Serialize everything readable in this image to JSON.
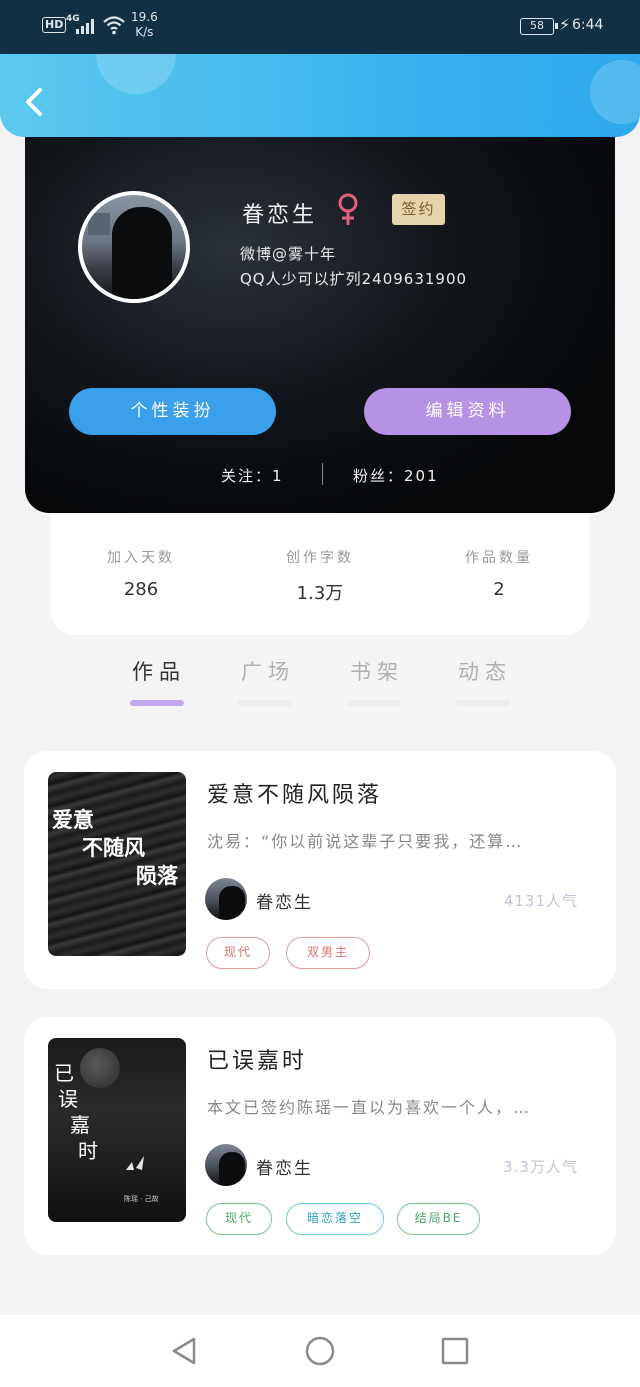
{
  "status_bar": {
    "hd": "HD",
    "network": "4G",
    "speed_value": "19.6",
    "speed_unit": "K/s",
    "battery": "58",
    "time": "6:44"
  },
  "header": {
    "back_icon": "chevron-left-icon"
  },
  "profile": {
    "name": "眷恋生",
    "gender_icon": "female-icon",
    "badge": "签约",
    "bio_line1": "微博@雾十年",
    "bio_line2": "QQ人少可以扩列2409631900",
    "dress_button": "个性装扮",
    "edit_button": "编辑资料",
    "following": "关注：1",
    "fans": "粉丝：201"
  },
  "stats": [
    {
      "label": "加入天数",
      "value": "286"
    },
    {
      "label": "创作字数",
      "value": "1.3万"
    },
    {
      "label": "作品数量",
      "value": "2"
    }
  ],
  "tabs": [
    {
      "label": "作品",
      "active": true
    },
    {
      "label": "广场",
      "active": false
    },
    {
      "label": "书架",
      "active": false
    },
    {
      "label": "动态",
      "active": false
    }
  ],
  "works": [
    {
      "title": "爱意不随风陨落",
      "cover_line1": "爱意",
      "cover_line2": "不随风",
      "cover_line3": "陨落",
      "description": "沈易：“你以前说这辈子只要我，还算…",
      "author": "眷恋生",
      "popularity": "4131人气",
      "tags": [
        "现代",
        "双男主"
      ]
    },
    {
      "title": "已误嘉时",
      "cover_chars": [
        "已",
        "误",
        "嘉",
        "时"
      ],
      "cover_caption": "陈瑶 · 己故",
      "description": "本文已签约陈瑶一直以为喜欢一个人，…",
      "author": "眷恋生",
      "popularity": "3.3万人气",
      "tags": [
        "现代",
        "暗恋落空",
        "结局BE"
      ]
    }
  ],
  "nav": {
    "back": "triangle-back-icon",
    "home": "circle-home-icon",
    "recents": "square-recents-icon"
  },
  "colors": {
    "header_blue": "#3ab4ee",
    "dress_button": "#3aa0ec",
    "edit_button": "#b592e6",
    "tab_underline": "#c2a8ec",
    "badge_bg": "#e5d3ac",
    "female_icon": "#e0607a"
  }
}
